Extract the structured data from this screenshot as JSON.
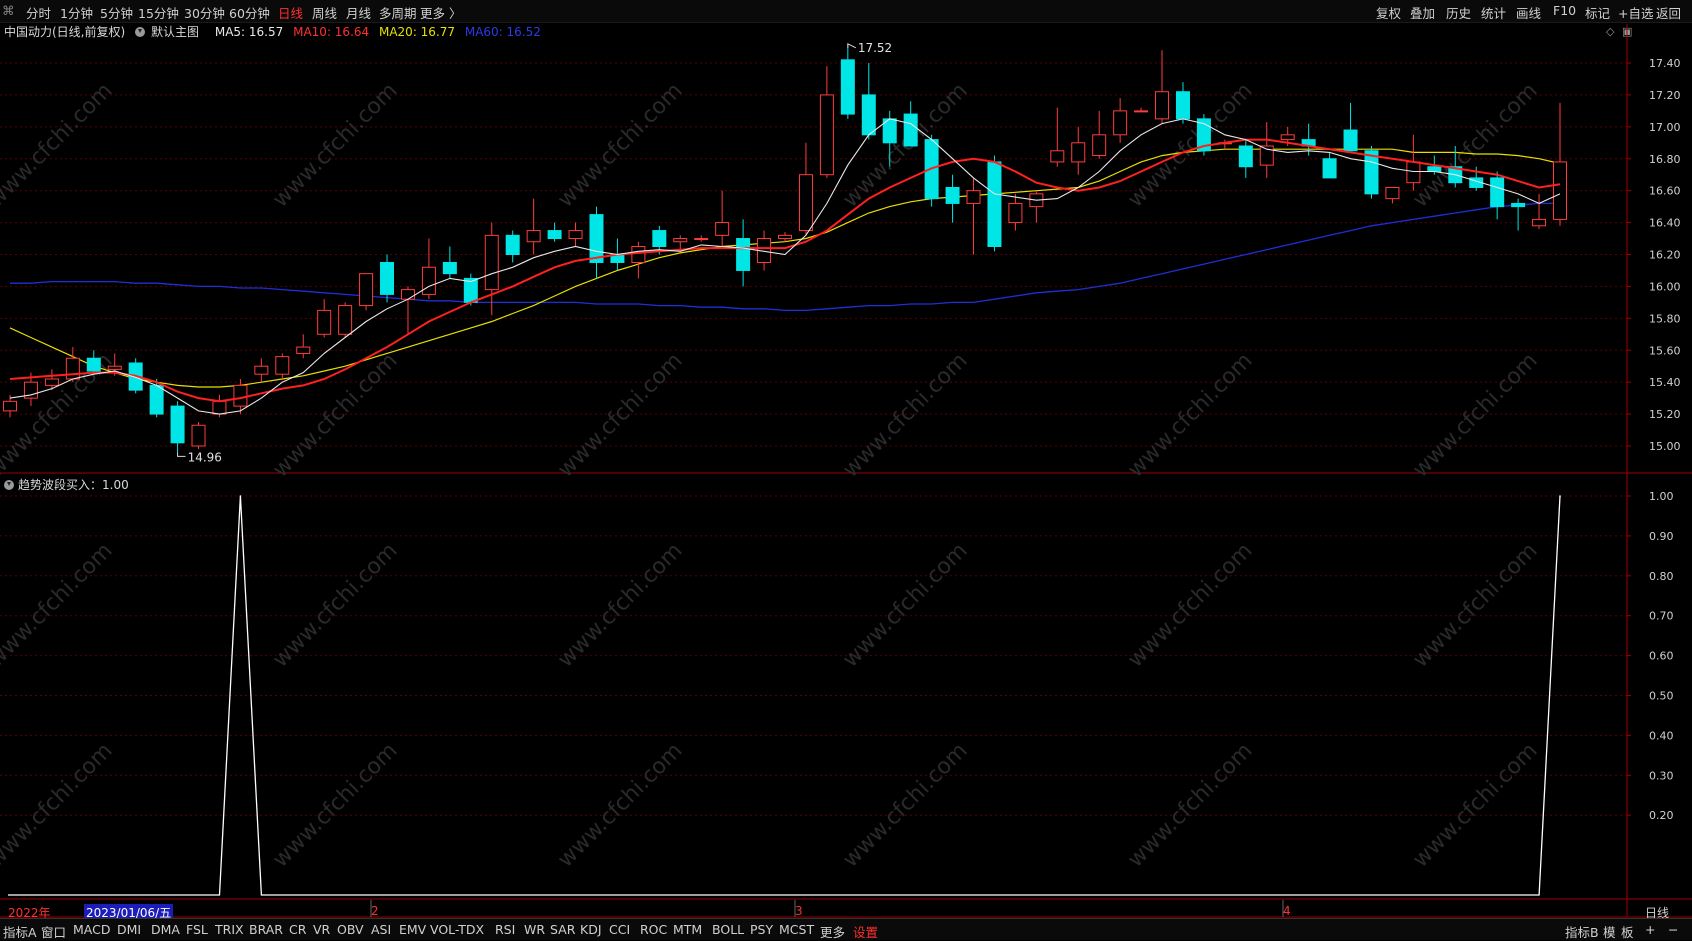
{
  "toolbar": {
    "left_items": [
      "分时",
      "1分钟",
      "5分钟",
      "15分钟",
      "30分钟",
      "60分钟",
      "日线",
      "周线",
      "月线",
      "多周期",
      "更多 〉"
    ],
    "active_item": "日线",
    "right_items": [
      "复权",
      "叠加",
      "历史",
      "统计",
      "画线",
      "F10",
      "标记",
      "+自选",
      "返回"
    ]
  },
  "legend": {
    "stock": "中国动力(日线,前复权)",
    "main_indicator": "默认主图",
    "ma5": "MA5: 16.57",
    "ma10": "MA10: 16.64",
    "ma20": "MA20: 16.77",
    "ma60": "MA60: 16.52"
  },
  "sub_legend": {
    "label": "趋势波段买入：1.00"
  },
  "colors": {
    "up": "#ff3c3c",
    "down": "#00e5e5",
    "ma5": "#e8e8e8",
    "ma10": "#ff2020",
    "ma20": "#e6e000",
    "ma60": "#1e2fd8",
    "grid": "#5a0000",
    "axis_border": "#a00000",
    "signal_line": "#ffffff"
  },
  "price_axis": {
    "ticks": [
      "17.40",
      "17.20",
      "17.00",
      "16.80",
      "16.60",
      "16.40",
      "16.20",
      "16.00",
      "15.80",
      "15.60",
      "15.40",
      "15.20",
      "15.00"
    ]
  },
  "sub_axis": {
    "ticks": [
      "1.00",
      "0.90",
      "0.80",
      "0.70",
      "0.60",
      "0.50",
      "0.40",
      "0.30",
      "0.20"
    ]
  },
  "annotations": {
    "high_label": "17.52",
    "low_label": "14.96"
  },
  "date_bar": {
    "year_label": "2022年",
    "cursor_date": "2023/01/06/五",
    "month_2": "2",
    "month_3": "3",
    "month_4": "4",
    "period": "日线"
  },
  "watermark_text": "www.cfchi.com",
  "bottom_tabs": [
    "指标A",
    "窗口",
    "MACD",
    "DMI",
    "DMA",
    "FSL",
    "TRIX",
    "BRAR",
    "CR",
    "VR",
    "OBV",
    "ASI",
    "EMV",
    "VOL-TDX",
    "RSI",
    "WR",
    "SAR",
    "KDJ",
    "CCI",
    "ROC",
    "MTM",
    "BOLL",
    "PSY",
    "MCST",
    "更多",
    "设置"
  ],
  "bottom_active": "设置",
  "bottom_right": [
    "指标B",
    "模",
    "板",
    "+",
    "−"
  ],
  "chart_data": [
    {
      "type": "candlestick",
      "ylim": [
        14.9,
        17.55
      ],
      "high_label": "17.52",
      "low_label": "14.96",
      "candles": [
        {
          "o": 15.22,
          "h": 15.32,
          "l": 15.18,
          "c": 15.28
        },
        {
          "o": 15.3,
          "h": 15.46,
          "l": 15.25,
          "c": 15.4
        },
        {
          "o": 15.38,
          "h": 15.48,
          "l": 15.35,
          "c": 15.42
        },
        {
          "o": 15.42,
          "h": 15.62,
          "l": 15.4,
          "c": 15.55
        },
        {
          "o": 15.55,
          "h": 15.6,
          "l": 15.45,
          "c": 15.47
        },
        {
          "o": 15.48,
          "h": 15.58,
          "l": 15.44,
          "c": 15.5
        },
        {
          "o": 15.52,
          "h": 15.55,
          "l": 15.33,
          "c": 15.35
        },
        {
          "o": 15.38,
          "h": 15.42,
          "l": 15.18,
          "c": 15.2
        },
        {
          "o": 15.25,
          "h": 15.28,
          "l": 14.96,
          "c": 15.02
        },
        {
          "o": 15.0,
          "h": 15.15,
          "l": 14.98,
          "c": 15.13
        },
        {
          "o": 15.2,
          "h": 15.32,
          "l": 15.18,
          "c": 15.28
        },
        {
          "o": 15.25,
          "h": 15.42,
          "l": 15.2,
          "c": 15.38
        },
        {
          "o": 15.45,
          "h": 15.55,
          "l": 15.4,
          "c": 15.5
        },
        {
          "o": 15.45,
          "h": 15.58,
          "l": 15.42,
          "c": 15.56
        },
        {
          "o": 15.58,
          "h": 15.7,
          "l": 15.55,
          "c": 15.62
        },
        {
          "o": 15.7,
          "h": 15.92,
          "l": 15.68,
          "c": 15.85
        },
        {
          "o": 15.7,
          "h": 15.9,
          "l": 15.68,
          "c": 15.88
        },
        {
          "o": 15.88,
          "h": 16.05,
          "l": 15.85,
          "c": 16.08
        },
        {
          "o": 16.15,
          "h": 16.2,
          "l": 15.9,
          "c": 15.95
        },
        {
          "o": 15.92,
          "h": 16.0,
          "l": 15.7,
          "c": 15.98
        },
        {
          "o": 15.95,
          "h": 16.3,
          "l": 15.92,
          "c": 16.12
        },
        {
          "o": 16.15,
          "h": 16.25,
          "l": 16.05,
          "c": 16.08
        },
        {
          "o": 16.05,
          "h": 16.08,
          "l": 15.88,
          "c": 15.9
        },
        {
          "o": 15.98,
          "h": 16.4,
          "l": 15.82,
          "c": 16.32
        },
        {
          "o": 16.32,
          "h": 16.35,
          "l": 16.15,
          "c": 16.2
        },
        {
          "o": 16.28,
          "h": 16.55,
          "l": 16.2,
          "c": 16.35
        },
        {
          "o": 16.35,
          "h": 16.4,
          "l": 16.28,
          "c": 16.3
        },
        {
          "o": 16.3,
          "h": 16.4,
          "l": 16.25,
          "c": 16.35
        },
        {
          "o": 16.45,
          "h": 16.5,
          "l": 16.05,
          "c": 16.15
        },
        {
          "o": 16.2,
          "h": 16.3,
          "l": 16.1,
          "c": 16.15
        },
        {
          "o": 16.15,
          "h": 16.28,
          "l": 16.05,
          "c": 16.25
        },
        {
          "o": 16.35,
          "h": 16.38,
          "l": 16.2,
          "c": 16.25
        },
        {
          "o": 16.28,
          "h": 16.32,
          "l": 16.22,
          "c": 16.3
        },
        {
          "o": 16.3,
          "h": 16.32,
          "l": 16.28,
          "c": 16.3
        },
        {
          "o": 16.32,
          "h": 16.6,
          "l": 16.25,
          "c": 16.4
        },
        {
          "o": 16.3,
          "h": 16.42,
          "l": 16.0,
          "c": 16.1
        },
        {
          "o": 16.15,
          "h": 16.35,
          "l": 16.1,
          "c": 16.3
        },
        {
          "o": 16.3,
          "h": 16.34,
          "l": 16.28,
          "c": 16.32
        },
        {
          "o": 16.35,
          "h": 16.9,
          "l": 16.32,
          "c": 16.7
        },
        {
          "o": 16.7,
          "h": 17.38,
          "l": 16.68,
          "c": 17.2
        },
        {
          "o": 17.42,
          "h": 17.52,
          "l": 17.05,
          "c": 17.08
        },
        {
          "o": 17.2,
          "h": 17.4,
          "l": 16.92,
          "c": 16.95
        },
        {
          "o": 17.05,
          "h": 17.1,
          "l": 16.75,
          "c": 16.9
        },
        {
          "o": 17.08,
          "h": 17.16,
          "l": 16.88,
          "c": 16.88
        },
        {
          "o": 16.92,
          "h": 16.95,
          "l": 16.5,
          "c": 16.55
        },
        {
          "o": 16.62,
          "h": 16.7,
          "l": 16.4,
          "c": 16.52
        },
        {
          "o": 16.52,
          "h": 16.68,
          "l": 16.2,
          "c": 16.6
        },
        {
          "o": 16.78,
          "h": 16.82,
          "l": 16.22,
          "c": 16.25
        },
        {
          "o": 16.4,
          "h": 16.58,
          "l": 16.35,
          "c": 16.52
        },
        {
          "o": 16.5,
          "h": 16.6,
          "l": 16.4,
          "c": 16.58
        },
        {
          "o": 16.78,
          "h": 17.12,
          "l": 16.75,
          "c": 16.85
        },
        {
          "o": 16.78,
          "h": 17.0,
          "l": 16.7,
          "c": 16.9
        },
        {
          "o": 16.82,
          "h": 17.1,
          "l": 16.8,
          "c": 16.95
        },
        {
          "o": 16.95,
          "h": 17.18,
          "l": 16.9,
          "c": 17.1
        },
        {
          "o": 17.1,
          "h": 17.12,
          "l": 17.1,
          "c": 17.1
        },
        {
          "o": 17.05,
          "h": 17.48,
          "l": 17.02,
          "c": 17.22
        },
        {
          "o": 17.22,
          "h": 17.28,
          "l": 17.02,
          "c": 17.05
        },
        {
          "o": 17.05,
          "h": 17.08,
          "l": 16.82,
          "c": 16.85
        },
        {
          "o": 16.9,
          "h": 16.92,
          "l": 16.86,
          "c": 16.9
        },
        {
          "o": 16.88,
          "h": 16.92,
          "l": 16.68,
          "c": 16.75
        },
        {
          "o": 16.76,
          "h": 17.03,
          "l": 16.68,
          "c": 16.88
        },
        {
          "o": 16.92,
          "h": 17.0,
          "l": 16.88,
          "c": 16.95
        },
        {
          "o": 16.92,
          "h": 17.02,
          "l": 16.82,
          "c": 16.88
        },
        {
          "o": 16.8,
          "h": 16.84,
          "l": 16.68,
          "c": 16.68
        },
        {
          "o": 16.98,
          "h": 17.15,
          "l": 16.85,
          "c": 16.85
        },
        {
          "o": 16.85,
          "h": 16.88,
          "l": 16.55,
          "c": 16.58
        },
        {
          "o": 16.55,
          "h": 16.6,
          "l": 16.52,
          "c": 16.62
        },
        {
          "o": 16.65,
          "h": 16.95,
          "l": 16.6,
          "c": 16.78
        },
        {
          "o": 16.75,
          "h": 16.82,
          "l": 16.7,
          "c": 16.72
        },
        {
          "o": 16.75,
          "h": 16.88,
          "l": 16.62,
          "c": 16.65
        },
        {
          "o": 16.68,
          "h": 16.75,
          "l": 16.6,
          "c": 16.62
        },
        {
          "o": 16.68,
          "h": 16.72,
          "l": 16.42,
          "c": 16.5
        },
        {
          "o": 16.52,
          "h": 16.55,
          "l": 16.35,
          "c": 16.5
        },
        {
          "o": 16.38,
          "h": 16.58,
          "l": 16.36,
          "c": 16.42
        },
        {
          "o": 16.42,
          "h": 17.15,
          "l": 16.38,
          "c": 16.78
        }
      ],
      "ma5": [
        15.3,
        15.32,
        15.36,
        15.42,
        15.45,
        15.47,
        15.43,
        15.38,
        15.3,
        15.22,
        15.2,
        15.22,
        15.3,
        15.4,
        15.46,
        15.58,
        15.68,
        15.78,
        15.86,
        15.92,
        16.0,
        16.05,
        16.03,
        16.08,
        16.12,
        16.18,
        16.22,
        16.25,
        16.22,
        16.2,
        16.22,
        16.23,
        16.22,
        16.26,
        16.25,
        16.24,
        16.22,
        16.2,
        16.32,
        16.52,
        16.76,
        16.95,
        17.05,
        17.02,
        16.92,
        16.8,
        16.68,
        16.58,
        16.56,
        16.54,
        16.55,
        16.62,
        16.72,
        16.85,
        16.95,
        17.02,
        17.05,
        17.02,
        16.95,
        16.92,
        16.86,
        16.84,
        16.85,
        16.84,
        16.8,
        16.78,
        16.74,
        16.72,
        16.72,
        16.7,
        16.66,
        16.62,
        16.58,
        16.52,
        16.58
      ],
      "ma10": [
        15.42,
        15.43,
        15.44,
        15.45,
        15.46,
        15.46,
        15.44,
        15.4,
        15.34,
        15.3,
        15.28,
        15.3,
        15.33,
        15.36,
        15.38,
        15.42,
        15.48,
        15.55,
        15.62,
        15.7,
        15.78,
        15.84,
        15.9,
        15.95,
        16.0,
        16.06,
        16.12,
        16.16,
        16.18,
        16.2,
        16.21,
        16.22,
        16.23,
        16.24,
        16.24,
        16.24,
        16.24,
        16.24,
        16.28,
        16.35,
        16.45,
        16.55,
        16.62,
        16.68,
        16.74,
        16.78,
        16.8,
        16.78,
        16.72,
        16.65,
        16.62,
        16.6,
        16.62,
        16.66,
        16.72,
        16.78,
        16.84,
        16.88,
        16.9,
        16.92,
        16.92,
        16.9,
        16.88,
        16.86,
        16.84,
        16.82,
        16.8,
        16.78,
        16.76,
        16.74,
        16.72,
        16.7,
        16.66,
        16.62,
        16.64
      ],
      "ma20": [
        15.74,
        15.68,
        15.62,
        15.56,
        15.5,
        15.46,
        15.42,
        15.4,
        15.38,
        15.37,
        15.37,
        15.38,
        15.4,
        15.42,
        15.44,
        15.47,
        15.5,
        15.54,
        15.58,
        15.62,
        15.66,
        15.7,
        15.74,
        15.78,
        15.83,
        15.88,
        15.94,
        16.0,
        16.05,
        16.1,
        16.14,
        16.18,
        16.21,
        16.23,
        16.25,
        16.26,
        16.27,
        16.28,
        16.3,
        16.34,
        16.4,
        16.46,
        16.5,
        16.53,
        16.55,
        16.56,
        16.57,
        16.58,
        16.59,
        16.6,
        16.61,
        16.62,
        16.66,
        16.72,
        16.78,
        16.82,
        16.84,
        16.85,
        16.86,
        16.86,
        16.86,
        16.86,
        16.86,
        16.86,
        16.86,
        16.86,
        16.86,
        16.84,
        16.84,
        16.84,
        16.83,
        16.83,
        16.82,
        16.8,
        16.77
      ],
      "ma60": [
        16.02,
        16.02,
        16.03,
        16.03,
        16.03,
        16.03,
        16.02,
        16.02,
        16.01,
        16.0,
        16.0,
        15.99,
        15.99,
        15.98,
        15.97,
        15.96,
        15.95,
        15.94,
        15.93,
        15.92,
        15.91,
        15.91,
        15.9,
        15.9,
        15.9,
        15.9,
        15.9,
        15.9,
        15.89,
        15.89,
        15.89,
        15.88,
        15.88,
        15.87,
        15.87,
        15.86,
        15.86,
        15.85,
        15.85,
        15.86,
        15.87,
        15.88,
        15.88,
        15.89,
        15.89,
        15.9,
        15.9,
        15.92,
        15.94,
        15.96,
        15.97,
        15.98,
        16.0,
        16.02,
        16.05,
        16.08,
        16.11,
        16.14,
        16.17,
        16.2,
        16.23,
        16.26,
        16.29,
        16.32,
        16.35,
        16.38,
        16.4,
        16.42,
        16.44,
        16.46,
        16.48,
        16.5,
        16.51,
        16.52,
        16.52
      ]
    },
    {
      "type": "line",
      "name": "趋势波段买入",
      "ylim": [
        0,
        1.0
      ],
      "values": [
        0,
        0,
        0,
        0,
        0,
        0,
        0,
        0,
        0,
        0,
        0,
        1,
        0,
        0,
        0,
        0,
        0,
        0,
        0,
        0,
        0,
        0,
        0,
        0,
        0,
        0,
        0,
        0,
        0,
        0,
        0,
        0,
        0,
        0,
        0,
        0,
        0,
        0,
        0,
        0,
        0,
        0,
        0,
        0,
        0,
        0,
        0,
        0,
        0,
        0,
        0,
        0,
        0,
        0,
        0,
        0,
        0,
        0,
        0,
        0,
        0,
        0,
        0,
        0,
        0,
        0,
        0,
        0,
        0,
        0,
        0,
        0,
        0,
        0,
        1
      ]
    }
  ]
}
